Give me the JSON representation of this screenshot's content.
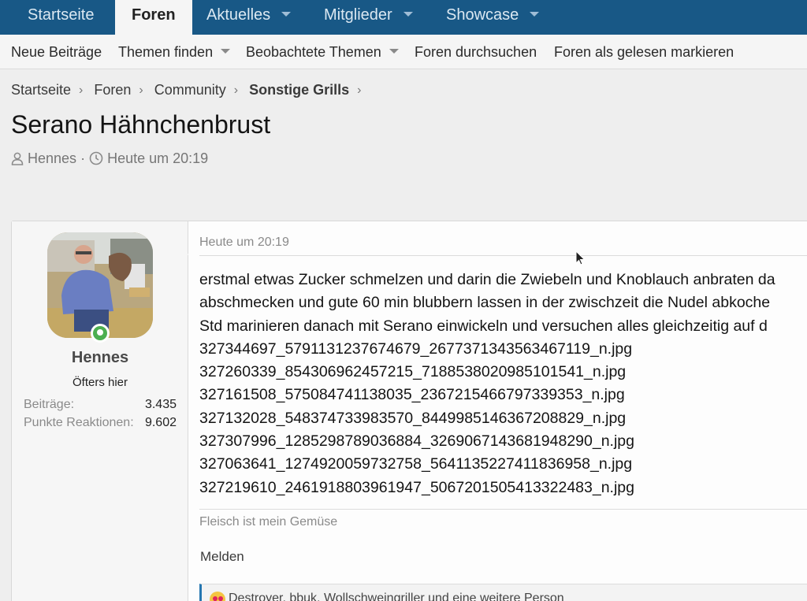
{
  "top_nav": {
    "items": [
      {
        "label": "Startseite",
        "active": false,
        "has_dropdown": false
      },
      {
        "label": "Foren",
        "active": true,
        "has_dropdown": false
      },
      {
        "label": "Aktuelles",
        "active": false,
        "has_dropdown": true
      },
      {
        "label": "Mitglieder",
        "active": false,
        "has_dropdown": true
      },
      {
        "label": "Showcase",
        "active": false,
        "has_dropdown": true
      }
    ]
  },
  "sub_nav": {
    "items": [
      {
        "label": "Neue Beiträge",
        "has_dropdown": false
      },
      {
        "label": "Themen finden",
        "has_dropdown": true
      },
      {
        "label": "Beobachtete Themen",
        "has_dropdown": true
      },
      {
        "label": "Foren durchsuchen",
        "has_dropdown": false
      },
      {
        "label": "Foren als gelesen markieren",
        "has_dropdown": false
      }
    ]
  },
  "breadcrumb": [
    "Startseite",
    "Foren",
    "Community",
    "Sonstige Grills"
  ],
  "thread": {
    "title": "Serano Hähnchenbrust",
    "author": "Hennes",
    "meta_separator": "·",
    "started": "Heute um 20:19"
  },
  "post": {
    "user": {
      "name": "Hennes",
      "title": "Öfters hier",
      "stats": [
        {
          "label": "Beiträge:",
          "value": "3.435"
        },
        {
          "label": "Punkte Reaktionen:",
          "value": "9.602"
        }
      ]
    },
    "date": "Heute um 20:19",
    "lines": [
      "erstmal etwas Zucker schmelzen und darin die Zwiebeln und Knoblauch anbraten da",
      "abschmecken und gute 60 min blubbern lassen in der zwischzeit die Nudel abkoche",
      "Std marinieren danach mit Serano einwickeln und versuchen alles gleichzeitig auf d",
      "327344697_5791131237674679_2677371343563467119_n.jpg",
      "327260339_854306962457215_7188538020985101541_n.jpg",
      "327161508_575084741138035_2367215466797339353_n.jpg",
      "327132028_548374733983570_8449985146367208829_n.jpg",
      "327307996_1285298789036884_3269067143681948290_n.jpg",
      "327063641_1274920059732758_5641135227411836958_n.jpg",
      "327219610_2461918803961947_5067201505413322483_n.jpg"
    ],
    "signature": "Fleisch ist mein Gemüse",
    "report_label": "Melden",
    "reactions_text": "Destroyer, bbuk, Wollschweingriller und eine weitere Person"
  },
  "colors": {
    "nav_bg": "#185886",
    "accent": "#2577b1",
    "online": "#4caf50"
  }
}
